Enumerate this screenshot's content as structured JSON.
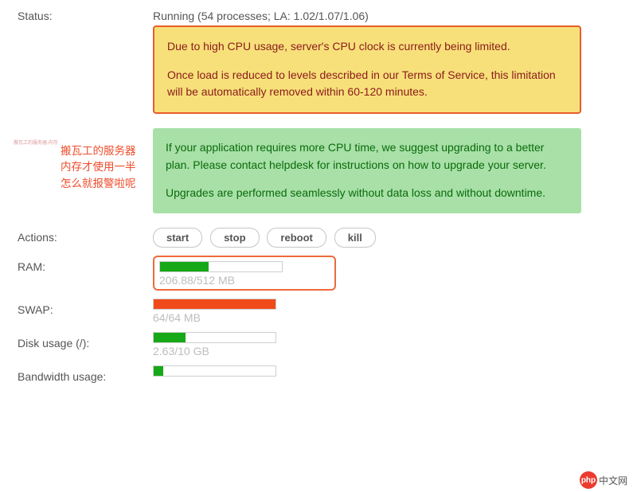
{
  "status": {
    "label": "Status:",
    "value": "Running (54 processes; LA: 1.02/1.07/1.06)"
  },
  "alerts": {
    "warn_p1": "Due to high CPU usage, server's CPU clock is currently being limited.",
    "warn_p2": "Once load is reduced to levels described in our Terms of Service, this limitation will be automatically removed within 60-120 minutes.",
    "info_p1": "If your application requires more CPU time, we suggest upgrading to a better plan. Please contact helpdesk for instructions on how to upgrade your server.",
    "info_p2": "Upgrades are performed seamlessly without data loss and without downtime."
  },
  "actions": {
    "label": "Actions:",
    "start": "start",
    "stop": "stop",
    "reboot": "reboot",
    "kill": "kill"
  },
  "ram": {
    "label": "RAM:",
    "text": "206.88/512 MB",
    "percent": 40
  },
  "swap": {
    "label": "SWAP:",
    "text": "64/64 MB",
    "percent": 100
  },
  "disk": {
    "label": "Disk usage (/):",
    "text": "2.63/10 GB",
    "percent": 26
  },
  "bandwidth": {
    "label": "Bandwidth usage:",
    "percent": 8
  },
  "annotation": {
    "l1": "搬瓦工的服务器",
    "l2": "内存才使用一半",
    "l3": "怎么就报警啦呢"
  },
  "logo": {
    "badge": "php",
    "text": "中文网"
  }
}
